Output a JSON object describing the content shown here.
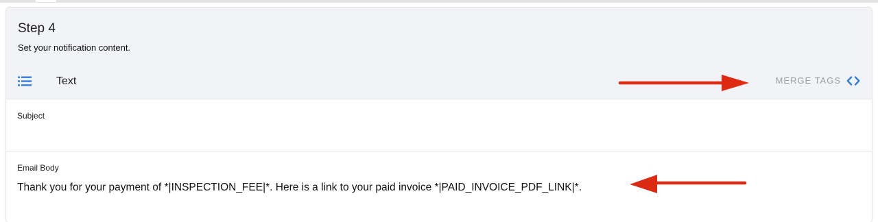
{
  "step": {
    "title": "Step 4",
    "subtitle": "Set your notification content."
  },
  "toolbar": {
    "mode_icon": "list-icon",
    "mode_label": "Text",
    "merge_tags_label": "MERGE TAGS",
    "merge_tags_icon": "code-icon"
  },
  "subject": {
    "label": "Subject",
    "value": ""
  },
  "email_body": {
    "label": "Email Body",
    "value": "Thank you for your payment of *|INSPECTION_FEE|*. Here is a link to your paid invoice *|PAID_INVOICE_PDF_LINK|*."
  },
  "colors": {
    "header_bg": "#f1f3f6",
    "accent_blue": "#2f7de1",
    "annotation_arrow": "#dd2a12",
    "muted_text": "#9aa0a6"
  }
}
